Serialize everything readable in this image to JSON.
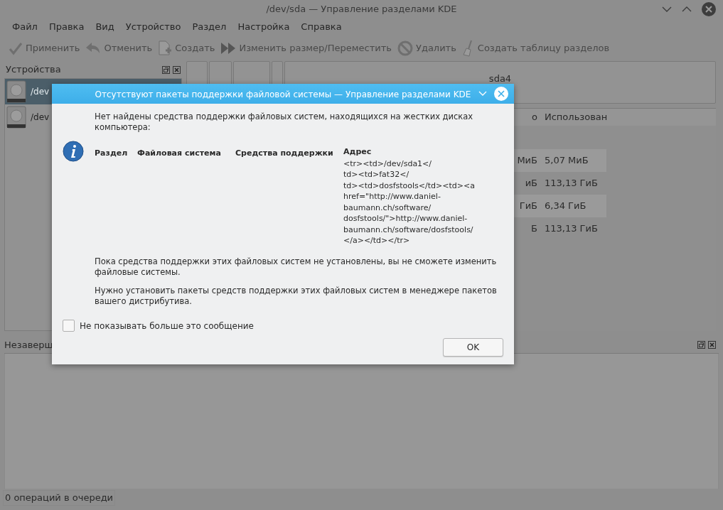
{
  "window": {
    "title": "/dev/sda — Управление разделами KDE"
  },
  "menu": [
    "Файл",
    "Правка",
    "Вид",
    "Устройство",
    "Раздел",
    "Настройка",
    "Справка"
  ],
  "toolbar": [
    {
      "kind": "check",
      "label": "Применить",
      "disabled": true
    },
    {
      "kind": "undo",
      "label": "Отменить",
      "disabled": true
    },
    {
      "kind": "new",
      "label": "Создать",
      "disabled": true
    },
    {
      "kind": "resize",
      "label": "Изменить размер/Переместить",
      "disabled": true
    },
    {
      "kind": "delete",
      "label": "Удалить",
      "disabled": true
    },
    {
      "kind": "broom",
      "label": "Создать таблицу разделов",
      "disabled": true
    }
  ],
  "devices_panel": {
    "title": "Устройства",
    "items": [
      {
        "label": "/dev",
        "selected": true
      },
      {
        "label": "/dev",
        "selected": false
      }
    ]
  },
  "partition_map": {
    "label": "sda4"
  },
  "table": {
    "columns": [
      "о",
      "Использован"
    ],
    "rows": [
      [
        "МиБ",
        "5,07 МиБ"
      ],
      [
        "иБ",
        "113,13 ГиБ"
      ],
      [
        "ГиБ",
        "6,34 ГиБ"
      ],
      [
        "Б",
        "113,13 ГиБ"
      ]
    ]
  },
  "pending_panel": {
    "title": "Незаверш"
  },
  "status_bar": "0 операций в очереди",
  "dialog": {
    "title": "Отсутствуют пакеты поддержки файловой системы — Управление разделами KDE",
    "intro": "Нет найдены средства поддержки файловых систем, находящихся на жестких дисках компьютера:",
    "columns": [
      "Раздел",
      "Файловая система",
      "Средства поддержки",
      "Адрес"
    ],
    "address_lines": [
      "<tr><td>/dev/sda1</",
      "td><td>fat32</",
      "td><td>dosfstools</td><td><a",
      "href=\"http://www.daniel-",
      "baumann.ch/software/",
      "dosfstools/\">http://www.daniel-",
      "baumann.ch/software/dosfstools/",
      "</a></td></tr>"
    ],
    "paragraphs": [
      "Пока средства поддержки этих файловых систем не установлены, вы не сможете изменить файловые системы.",
      "Нужно установить пакеты средств поддержки этих файловых систем в менеджере пакетов вашего дистрибутива."
    ],
    "checkbox": {
      "label": "Не показывать больше это сообщение",
      "checked": false
    },
    "button": "OK"
  }
}
